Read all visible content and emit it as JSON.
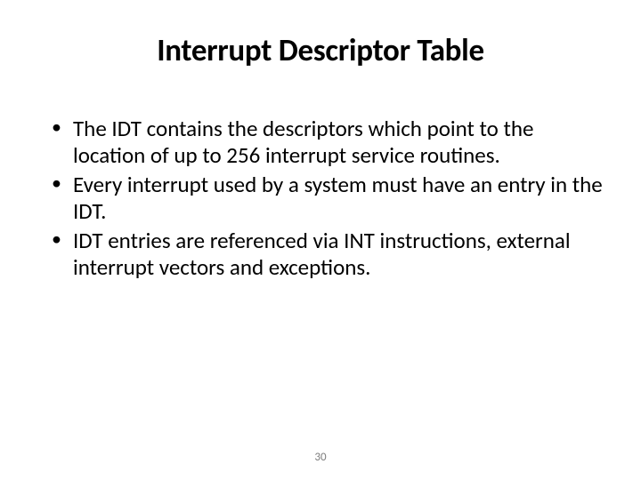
{
  "title": "Interrupt Descriptor Table",
  "bullets": [
    "The IDT contains the descriptors which point to the location of up to 256 interrupt service routines.",
    "Every interrupt used by a system must have an entry in the IDT.",
    "IDT entries are referenced via INT instructions, external interrupt vectors and exceptions."
  ],
  "page_number": "30"
}
